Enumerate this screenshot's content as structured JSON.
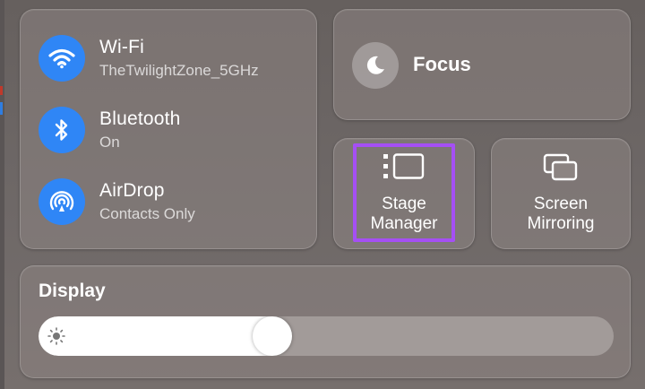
{
  "network": {
    "wifi": {
      "title": "Wi-Fi",
      "subtitle": "TheTwilightZone_5GHz",
      "icon": "wifi-icon"
    },
    "bluetooth": {
      "title": "Bluetooth",
      "subtitle": "On",
      "icon": "bluetooth-icon"
    },
    "airdrop": {
      "title": "AirDrop",
      "subtitle": "Contacts Only",
      "icon": "airdrop-icon"
    }
  },
  "focus": {
    "label": "Focus",
    "icon": "moon-icon"
  },
  "stage_manager": {
    "line1": "Stage",
    "line2": "Manager",
    "icon": "stage-manager-icon",
    "highlighted": true
  },
  "screen_mirroring": {
    "line1": "Screen",
    "line2": "Mirroring",
    "icon": "screen-mirroring-icon"
  },
  "display": {
    "label": "Display",
    "brightness": 0.4,
    "icon": "sun-icon"
  },
  "colors": {
    "accent_blue": "#2f86f6",
    "highlight_purple": "#a54ff4"
  }
}
